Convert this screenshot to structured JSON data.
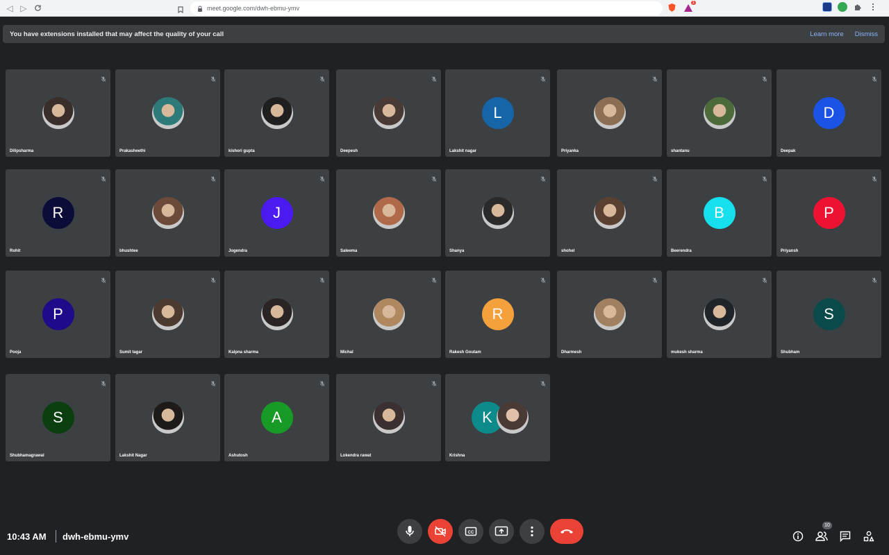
{
  "browser": {
    "url": "meet.google.com/dwh-ebmu-ymv",
    "notification_count": "1"
  },
  "banner": {
    "message": "You have extensions installed that may affect the quality of your call",
    "learn_more": "Learn more",
    "dismiss": "Dismiss"
  },
  "participants": [
    {
      "name": "Dilipsharma",
      "type": "photo",
      "skin": "#3a2e2a"
    },
    {
      "name": "Prakasheethi",
      "type": "photo",
      "skin": "#2d7a7a"
    },
    {
      "name": "kishori gupta",
      "type": "photo",
      "skin": "#1f1f1f"
    },
    {
      "name": "Deepesh",
      "type": "photo",
      "skin": "#4a3a35"
    },
    {
      "name": "Lakshit nagar",
      "type": "letter",
      "letter": "L",
      "color": "#1565a8"
    },
    {
      "name": "Priyanka",
      "type": "photo",
      "skin": "#8c6e55"
    },
    {
      "name": "shantanu",
      "type": "photo",
      "skin": "#4d6b3a"
    },
    {
      "name": "Deepak",
      "type": "letter",
      "letter": "D",
      "color": "#1a53e6"
    },
    {
      "name": "Rohit",
      "type": "letter",
      "letter": "R",
      "color": "#0c0c38"
    },
    {
      "name": "bhushtee",
      "type": "photo",
      "skin": "#6b4a3a"
    },
    {
      "name": "Jogendra",
      "type": "letter",
      "letter": "J",
      "color": "#4a1af0"
    },
    {
      "name": "Saleema",
      "type": "photo",
      "skin": "#b06a4a"
    },
    {
      "name": "Shanya",
      "type": "photo",
      "skin": "#2a2a2a"
    },
    {
      "name": "shohel",
      "type": "photo",
      "skin": "#5a4030"
    },
    {
      "name": "Beerendra",
      "type": "letter",
      "letter": "B",
      "color": "#16e0ee"
    },
    {
      "name": "Priyansh",
      "type": "letter",
      "letter": "P",
      "color": "#ee1232"
    },
    {
      "name": "Pooja",
      "type": "letter",
      "letter": "P",
      "color": "#1f0a8a"
    },
    {
      "name": "Sumit tagar",
      "type": "photo",
      "skin": "#4a3a30"
    },
    {
      "name": "Kalpna sharma",
      "type": "photo",
      "skin": "#2a2424"
    },
    {
      "name": "Michal",
      "type": "photo",
      "skin": "#b08860"
    },
    {
      "name": "Rakesh Goutam",
      "type": "letter",
      "letter": "R",
      "color": "#f4a03c"
    },
    {
      "name": "Dharmesh",
      "type": "photo",
      "skin": "#a08060"
    },
    {
      "name": "mukesh sharma",
      "type": "photo",
      "skin": "#1f2428"
    },
    {
      "name": "Shubham",
      "type": "letter",
      "letter": "S",
      "color": "#0b4a4a"
    },
    {
      "name": "Shubhamagrawal",
      "type": "letter",
      "letter": "S",
      "color": "#0b3f10"
    },
    {
      "name": "Lakshit Nagar",
      "type": "photo",
      "skin": "#1f1a1a"
    },
    {
      "name": "Ashutosh",
      "type": "letter",
      "letter": "A",
      "color": "#189a26"
    },
    {
      "name": "Lokendra rawat",
      "type": "photo",
      "skin": "#3a3030"
    },
    {
      "name": "Krishna",
      "type": "pair",
      "letter": "K",
      "color": "#0d8a8a",
      "skin": "#4a3a35"
    }
  ],
  "bottom_bar": {
    "time": "10:43 AM",
    "meeting_code": "dwh-ebmu-ymv",
    "participant_count": "10"
  }
}
